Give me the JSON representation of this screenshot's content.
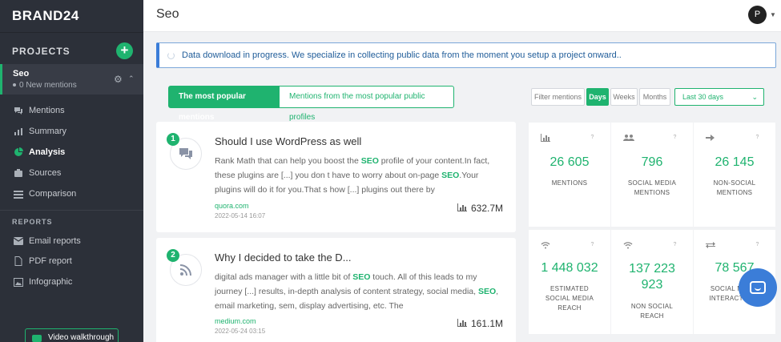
{
  "brand": "BRAND24",
  "sidebar": {
    "projects_label": "PROJECTS",
    "add_button": "+",
    "project": {
      "name": "Seo",
      "sub": "0 New mentions"
    },
    "nav": [
      {
        "label": "Mentions"
      },
      {
        "label": "Summary"
      },
      {
        "label": "Analysis"
      },
      {
        "label": "Sources"
      },
      {
        "label": "Comparison"
      }
    ],
    "reports_label": "REPORTS",
    "reports": [
      {
        "label": "Email reports"
      },
      {
        "label": "PDF report"
      },
      {
        "label": "Infographic"
      }
    ],
    "video_button": "Video walkthrough"
  },
  "header": {
    "title": "Seo",
    "avatar": "P"
  },
  "notice": {
    "text": "Data download in progress. We specialize in collecting public data from the moment you setup a project onward.."
  },
  "toolbar": {
    "tab_popular": "The most popular mentions",
    "tab_profiles": "Mentions from the most popular public profiles",
    "filter": "Filter mentions",
    "days": "Days",
    "weeks": "Weeks",
    "months": "Months",
    "range": "Last 30 days"
  },
  "mentions": [
    {
      "rank": "1",
      "title": "Should I use WordPress as well",
      "text_1": "Rank Math that can help you boost the ",
      "kw_1": "SEO",
      "text_2": " profile of your content.In fact, these plugins are [...] you don t have to worry about on-page ",
      "kw_2": "SEO",
      "text_3": ".Your plugins will do it for you.That s how [...] plugins out there by",
      "domain": "quora.com",
      "date": "2022-05-14 16:07",
      "reach": "632.7M"
    },
    {
      "rank": "2",
      "title": "Why I decided to take the D...",
      "text_1": "digital ads manager with a little bit of ",
      "kw_1": "SEO",
      "text_2": " touch. All of this leads to my journey [...] results, in-depth analysis of content strategy, social media, ",
      "kw_2": "SEO",
      "text_3": ", email marketing, sem, display advertising, etc. The",
      "domain": "medium.com",
      "date": "2022-05-24 03:15",
      "reach": "161.1M"
    }
  ],
  "stats": [
    {
      "value": "26 605",
      "label": "MENTIONS"
    },
    {
      "value": "796",
      "label": "SOCIAL MEDIA MENTIONS"
    },
    {
      "value": "26 145",
      "label": "NON-SOCIAL MENTIONS"
    },
    {
      "value": "1 448 032",
      "label": "ESTIMATED SOCIAL MEDIA REACH"
    },
    {
      "value": "137 223 923",
      "label": "NON SOCIAL REACH"
    },
    {
      "value": "78 567",
      "label": "SOCIAL MEDIA INTERACTIONS"
    }
  ],
  "help_glyph": "?",
  "colors": {
    "accent": "#1fb36f",
    "sidebar": "#2c3039",
    "info": "#3b7dd8"
  }
}
